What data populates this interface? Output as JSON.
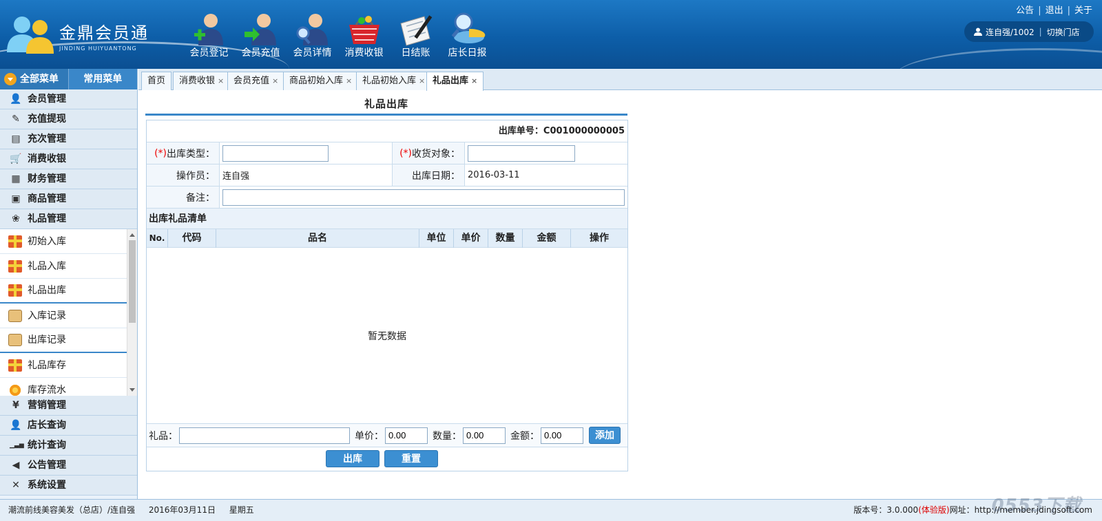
{
  "header": {
    "brand_cn": "金鼎会员通",
    "brand_en": "JINDING HUIYUANTONG",
    "toolbar": [
      {
        "label": "会员登记",
        "icon": "member-register-icon"
      },
      {
        "label": "会员充值",
        "icon": "member-recharge-icon"
      },
      {
        "label": "会员详情",
        "icon": "member-detail-icon"
      },
      {
        "label": "消费收银",
        "icon": "shopping-basket-icon"
      },
      {
        "label": "日结账",
        "icon": "daily-checkout-icon"
      },
      {
        "label": "店长日报",
        "icon": "manager-report-icon"
      }
    ],
    "links": {
      "notice": "公告",
      "logout": "退出",
      "about": "关于"
    },
    "user": {
      "name": "连自强/1002",
      "switch_store": "切换门店"
    }
  },
  "sidebar": {
    "tabs": {
      "all": "全部菜单",
      "common": "常用菜单"
    },
    "menus_top": [
      {
        "label": "会员管理",
        "icon": "user-icon"
      },
      {
        "label": "充值提现",
        "icon": "edit-icon"
      },
      {
        "label": "充次管理",
        "icon": "card-icon"
      },
      {
        "label": "消费收银",
        "icon": "cart-icon"
      },
      {
        "label": "财务管理",
        "icon": "calendar-icon"
      },
      {
        "label": "商品管理",
        "icon": "box-icon"
      },
      {
        "label": "礼品管理",
        "icon": "gift-icon"
      }
    ],
    "submenu": [
      {
        "label": "初始入库",
        "icon": "gift-icon"
      },
      {
        "label": "礼品入库",
        "icon": "gift-icon"
      },
      {
        "label": "礼品出库",
        "icon": "gift-icon"
      },
      {
        "label": "入库记录",
        "icon": "scroll-icon"
      },
      {
        "label": "出库记录",
        "icon": "scroll-icon"
      },
      {
        "label": "礼品库存",
        "icon": "gift-icon"
      },
      {
        "label": "库存流水",
        "icon": "flower-icon"
      }
    ],
    "menus_bottom": [
      {
        "label": "营销管理",
        "icon": "yen-icon"
      },
      {
        "label": "店长查询",
        "icon": "user-icon"
      },
      {
        "label": "统计查询",
        "icon": "bar-chart-icon"
      },
      {
        "label": "公告管理",
        "icon": "speaker-icon"
      },
      {
        "label": "系统设置",
        "icon": "tools-icon"
      }
    ]
  },
  "tabs": [
    {
      "label": "首页",
      "closable": false
    },
    {
      "label": "消费收银",
      "closable": true
    },
    {
      "label": "会员充值",
      "closable": true
    },
    {
      "label": "商品初始入库",
      "closable": true
    },
    {
      "label": "礼品初始入库",
      "closable": true
    },
    {
      "label": "礼品出库",
      "closable": true,
      "active": true
    }
  ],
  "form": {
    "title": "礼品出库",
    "order_no_label": "出库单号：",
    "order_no": "C001000000005",
    "req_mark": "(*)",
    "out_type_label": "出库类型：",
    "out_type_value": "",
    "receiver_label": "收货对象：",
    "receiver_value": "",
    "operator_label": "操作员：",
    "operator_value": "连自强",
    "date_label": "出库日期：",
    "date_value": "2016-03-11",
    "remark_label": "备注：",
    "remark_value": "",
    "list_title": "出库礼品清单",
    "columns": [
      "No.",
      "代码",
      "品名",
      "单位",
      "单价",
      "数量",
      "金额",
      "操作"
    ],
    "rows": [],
    "empty_text": "暂无数据",
    "add": {
      "gift_label": "礼品：",
      "gift_value": "",
      "price_label": "单价：",
      "price_value": "0.00",
      "qty_label": "数量：",
      "qty_value": "0.00",
      "amount_label": "金额：",
      "amount_value": "0.00",
      "add_button": "添加"
    },
    "submit_button": "出库",
    "reset_button": "重置"
  },
  "footer": {
    "store": "潮流前线美容美发（总店）/连自强",
    "date": "2016年03月11日",
    "weekday": "星期五",
    "version_label": "版本号：3.0.000",
    "trial": "(体验版)",
    "site_label": "网址：http://member.jdingsoft.com",
    "watermark": "0553下载"
  },
  "colors": {
    "header_bg": "#0d5ea8",
    "accent": "#3a87c9",
    "required": "#e00000",
    "trial": "#d00000"
  }
}
